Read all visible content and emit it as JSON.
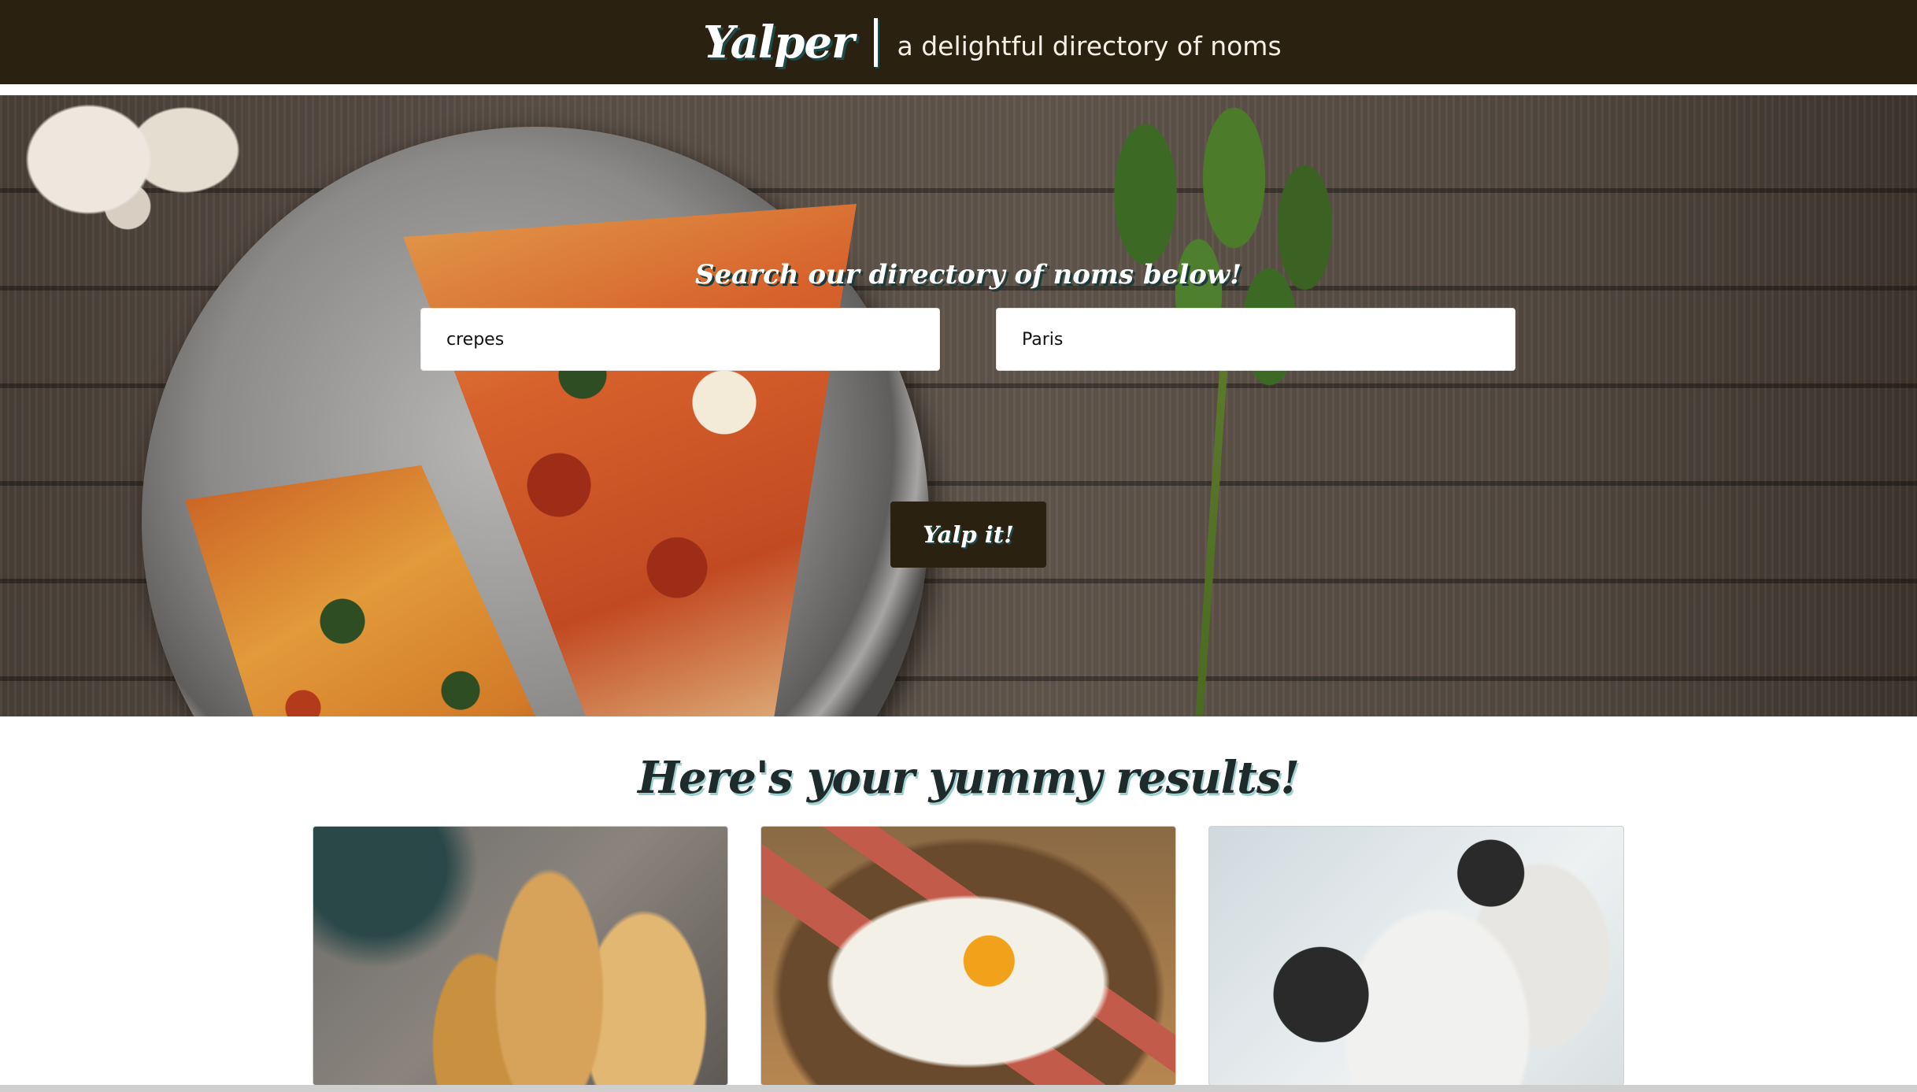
{
  "header": {
    "brand_name": "Yalper",
    "tagline": "a delightful directory of noms"
  },
  "hero": {
    "heading": "Search our directory of noms below!",
    "search_term_value": "crepes",
    "search_location_value": "Paris",
    "submit_label": "Yalp it!"
  },
  "results": {
    "heading": "Here's your yummy results!",
    "cards": [
      {
        "image": "crepe-wraps-photo"
      },
      {
        "image": "bacon-egg-galette-photo"
      },
      {
        "image": "crepes-with-coffee-photo"
      }
    ]
  },
  "colors": {
    "header_bg": "#2a2111",
    "button_bg": "#2a2111",
    "text_shadow_accent": "#1d4a4a",
    "heading_text": "#1f2a2a"
  }
}
